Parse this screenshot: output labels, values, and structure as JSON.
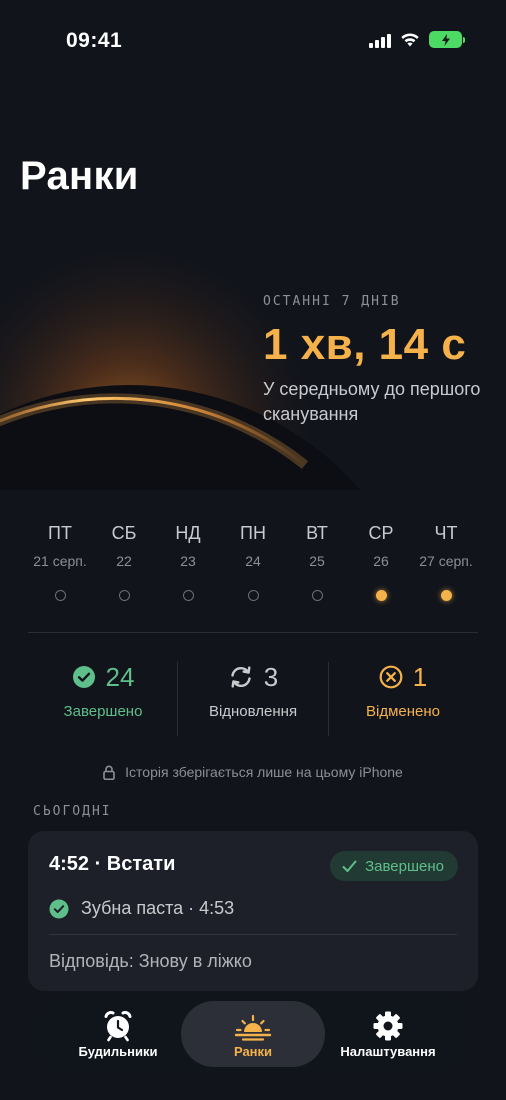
{
  "status_bar": {
    "time": "09:41"
  },
  "header": {
    "title": "Ранки"
  },
  "summary": {
    "kicker": "ОСТАННІ 7 ДНІВ",
    "value": "1 хв, 14 с",
    "description": "У середньому до першого сканування"
  },
  "week": [
    {
      "day": "ПТ",
      "date": "21 серп.",
      "active": false
    },
    {
      "day": "СБ",
      "date": "22",
      "active": false
    },
    {
      "day": "НД",
      "date": "23",
      "active": false
    },
    {
      "day": "ПН",
      "date": "24",
      "active": false
    },
    {
      "day": "ВТ",
      "date": "25",
      "active": false
    },
    {
      "day": "СР",
      "date": "26",
      "active": true
    },
    {
      "day": "ЧТ",
      "date": "27 серп.",
      "active": true
    }
  ],
  "stats": {
    "completed": {
      "value": "24",
      "label": "Завершено"
    },
    "restored": {
      "value": "3",
      "label": "Відновлення"
    },
    "cancelled": {
      "value": "1",
      "label": "Відменено"
    }
  },
  "privacy_note": "Історія зберігається лише на цьому iPhone",
  "today": {
    "section_label": "СЬОГОДНІ",
    "entry": {
      "title": "4:52 · Встати",
      "status": "Завершено",
      "step": "Зубна паста · 4:53",
      "response": "Відповідь: Знову в ліжко"
    }
  },
  "tabs": {
    "alarms": "Будильники",
    "mornings": "Ранки",
    "settings": "Налаштування"
  },
  "colors": {
    "accent": "#f6b24a",
    "success": "#5fbf8a",
    "background": "#11141b"
  }
}
